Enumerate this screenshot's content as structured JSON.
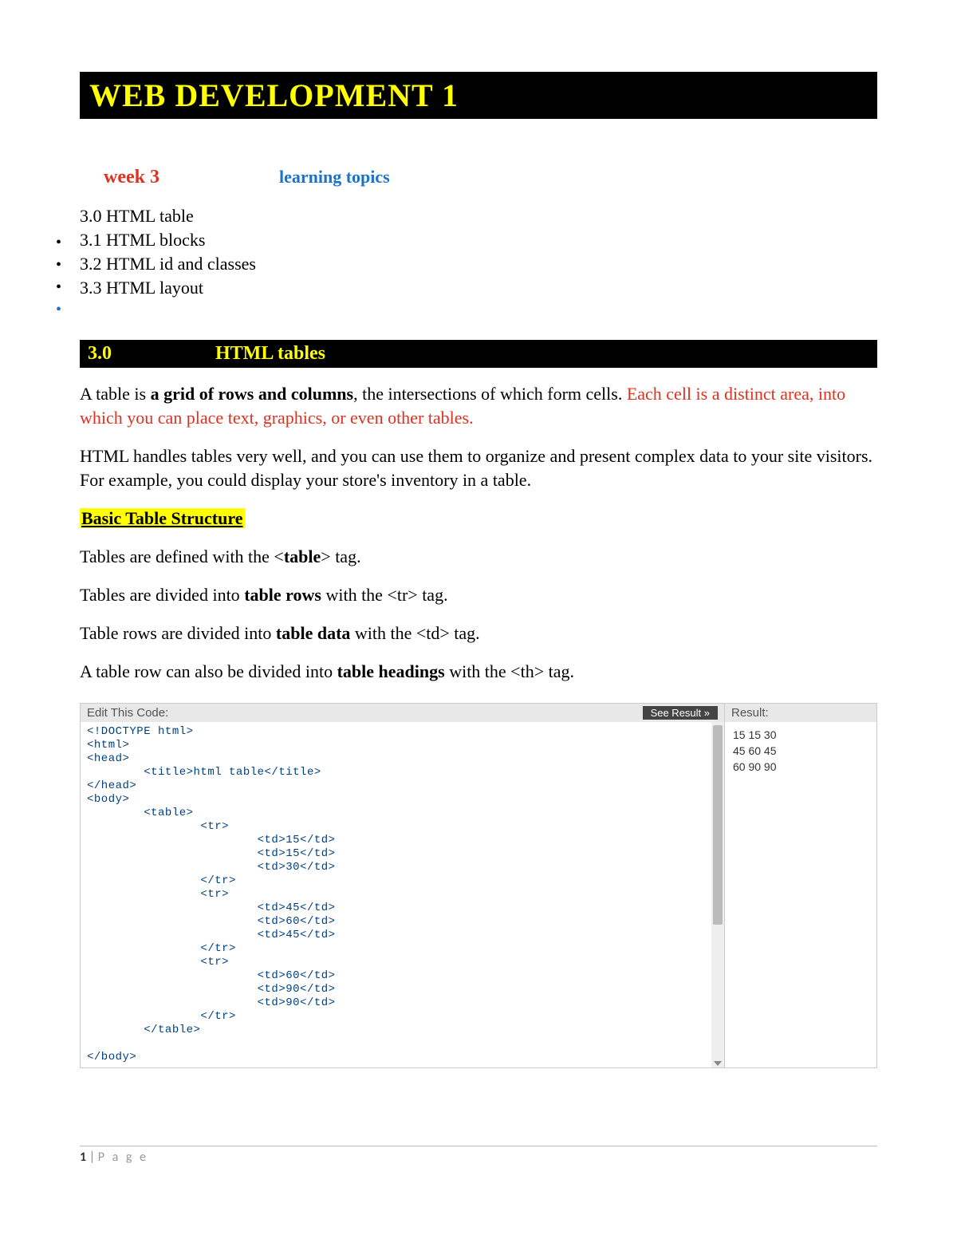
{
  "title": "WEB DEVELOPMENT  1",
  "week_label": "week 3",
  "learning_label": "learning topics",
  "topics": {
    "t0": "3.0 HTML table",
    "t1": "3.1 HTML blocks",
    "t2": "3.2 HTML id and classes",
    "t3": "3.3 HTML layout"
  },
  "section": {
    "num": "3.0",
    "name": "HTML tables"
  },
  "para1": {
    "a": "A table is ",
    "b": "a grid of rows and columns",
    "c": ", the intersections of which form cells. ",
    "d": "Each cell is a distinct area, into which you can place text, graphics, or even other tables."
  },
  "para2": "HTML handles tables very well, and you can use them to organize and present complex data to your site visitors. For example, you could display your store's inventory in a table.",
  "basic_heading": "Basic Table Structure",
  "line_table": {
    "a": "Tables are defined with the <",
    "b": "table",
    "c": "> tag."
  },
  "line_tr": {
    "a": "Tables are divided into ",
    "b": "table rows",
    "c": " with the <tr> tag."
  },
  "line_td": {
    "a": "Table rows are divided into ",
    "b": "table data",
    "c": " with the <td> tag."
  },
  "line_th": {
    "a": "A table row can also be divided into ",
    "b": "table headings",
    "c": " with the <th> tag."
  },
  "codepanel": {
    "edit_label": "Edit This Code:",
    "see_result": "See Result »",
    "result_label": "Result:",
    "code": "<!DOCTYPE html>\n<html>\n<head>\n        <title>html table</title>\n</head>\n<body>\n        <table>\n                <tr>\n                        <td>15</td>\n                        <td>15</td>\n                        <td>30</td>\n                </tr>\n                <tr>\n                        <td>45</td>\n                        <td>60</td>\n                        <td>45</td>\n                </tr>\n                <tr>\n                        <td>60</td>\n                        <td>90</td>\n                        <td>90</td>\n                </tr>\n        </table>\n\n</body>",
    "result_lines": {
      "r0": "15 15 30",
      "r1": "45 60 45",
      "r2": "60 90 90"
    }
  },
  "footer": {
    "num": "1",
    "pipe": " | ",
    "word": "P a g e"
  }
}
